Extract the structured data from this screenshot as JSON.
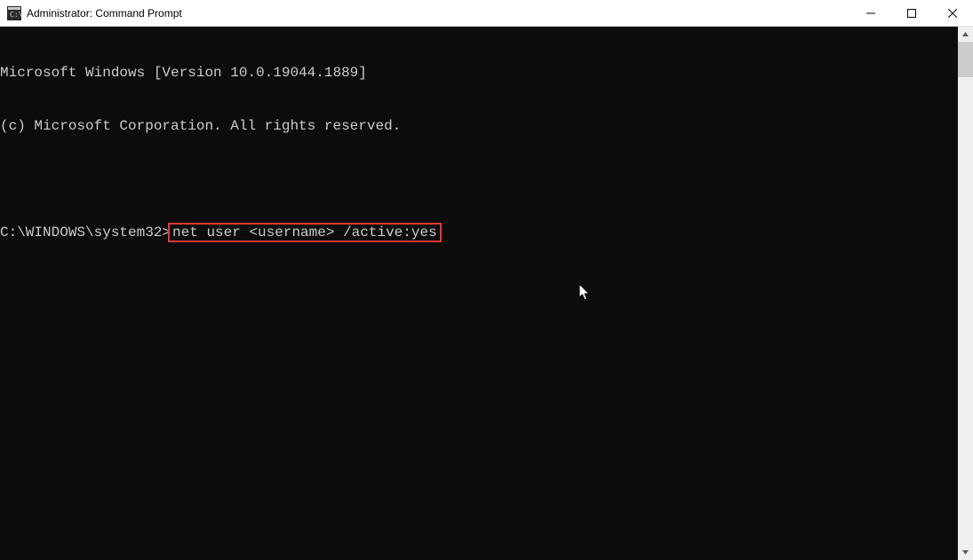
{
  "window": {
    "title": "Administrator: Command Prompt"
  },
  "terminal": {
    "line1": "Microsoft Windows [Version 10.0.19044.1889]",
    "line2": "(c) Microsoft Corporation. All rights reserved.",
    "prompt_path": "C:\\WINDOWS\\system32>",
    "command": "net user <username> /active:yes"
  }
}
